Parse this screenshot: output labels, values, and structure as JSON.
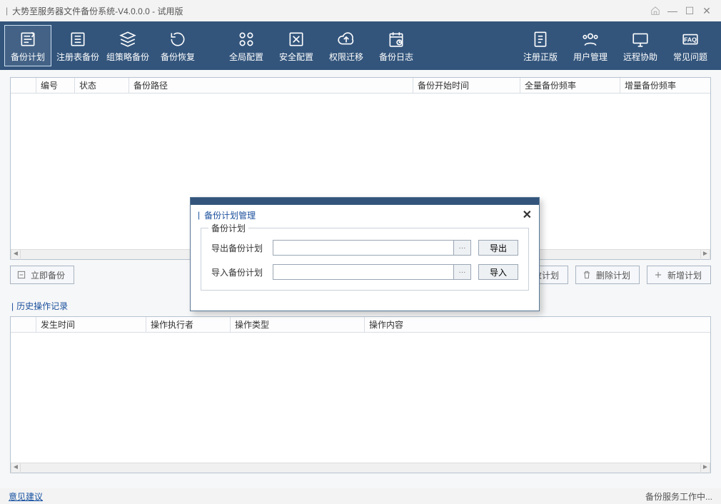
{
  "window": {
    "title": "大势至服务器文件备份系统-V4.0.0.0 - 试用版"
  },
  "toolbar": {
    "items": [
      {
        "label": "备份计划"
      },
      {
        "label": "注册表备份"
      },
      {
        "label": "组策略备份"
      },
      {
        "label": "备份恢复"
      },
      {
        "label": "全局配置"
      },
      {
        "label": "安全配置"
      },
      {
        "label": "权限迁移"
      },
      {
        "label": "备份日志"
      },
      {
        "label": "注册正版"
      },
      {
        "label": "用户管理"
      },
      {
        "label": "远程协助"
      },
      {
        "label": "常见问题"
      }
    ]
  },
  "grid1": {
    "columns": [
      "",
      "编号",
      "状态",
      "备份路径",
      "备份开始时间",
      "全量备份频率",
      "增量备份频率"
    ]
  },
  "actions": {
    "backup_now": "立即备份",
    "modify_plan": "改计划",
    "delete_plan": "删除计划",
    "add_plan": "新增计划"
  },
  "history": {
    "title": "历史操作记录",
    "columns": [
      "",
      "发生时间",
      "操作执行者",
      "操作类型",
      "操作内容"
    ]
  },
  "status": {
    "feedback": "意见建议",
    "working": "备份服务工作中..."
  },
  "modal": {
    "title": "备份计划管理",
    "group": "备份计划",
    "export_label": "导出备份计划",
    "import_label": "导入备份计划",
    "export_btn": "导出",
    "import_btn": "导入",
    "export_value": "",
    "import_value": ""
  }
}
